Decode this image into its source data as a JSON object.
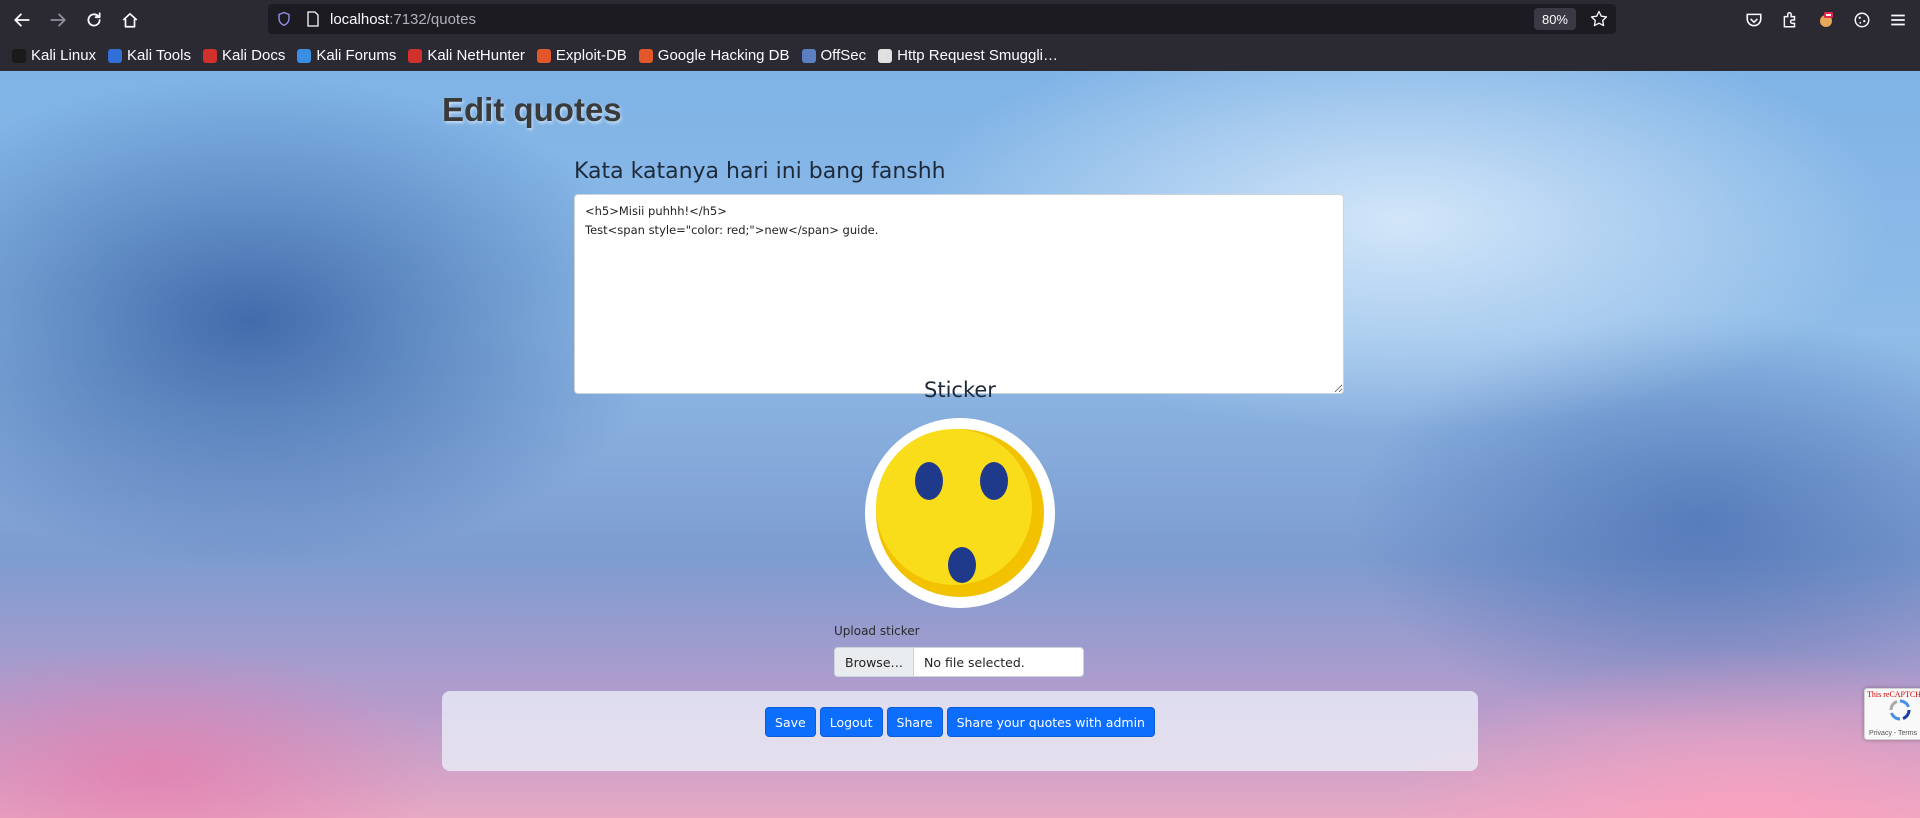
{
  "browser": {
    "url_host": "localhost",
    "url_path": ":7132/quotes",
    "zoom": "80%"
  },
  "bookmarks": [
    {
      "label": "Kali Linux",
      "color": "#1a1a1a"
    },
    {
      "label": "Kali Tools",
      "color": "#2f6fd6"
    },
    {
      "label": "Kali Docs",
      "color": "#d0312d"
    },
    {
      "label": "Kali Forums",
      "color": "#3a8de0"
    },
    {
      "label": "Kali NetHunter",
      "color": "#d0312d"
    },
    {
      "label": "Exploit-DB",
      "color": "#e2582b"
    },
    {
      "label": "Google Hacking DB",
      "color": "#e2582b"
    },
    {
      "label": "OffSec",
      "color": "#5c7fc2"
    },
    {
      "label": "Http Request Smuggli…",
      "color": "#e0e0e0"
    }
  ],
  "page": {
    "title": "Edit quotes",
    "quote_label": "Kata katanya hari ini bang fanshh",
    "quote_text": "<h5>Misii puhhh!</h5>\nTest<span style=\"color: red;\">new</span> guide.",
    "sticker_label": "Sticker",
    "upload_label": "Upload sticker",
    "browse_label": "Browse…",
    "file_status": "No file selected."
  },
  "buttons": {
    "save": "Save",
    "logout": "Logout",
    "share": "Share",
    "share_admin": "Share your quotes with admin"
  },
  "recaptcha": {
    "text": "This reCAPTCHA is for testing purposes only. Please report to the site admin if you are seeing this.",
    "footer": "Privacy - Terms"
  },
  "colors": {
    "primary": "#0d6efd",
    "chrome": "#2b2a33",
    "sticker_face": "#f7d21a",
    "sticker_features": "#1f3a8a"
  }
}
